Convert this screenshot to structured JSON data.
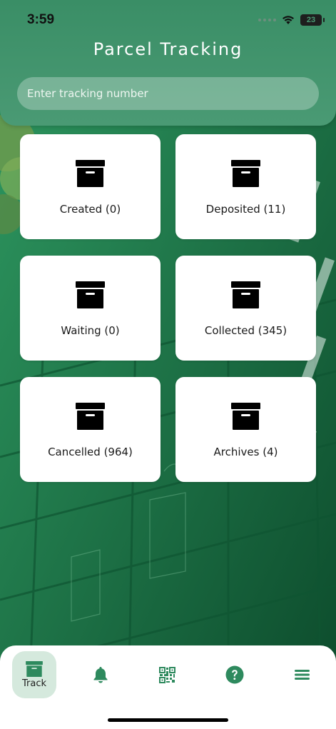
{
  "status_bar": {
    "time": "3:59",
    "battery": "23"
  },
  "header": {
    "title": "Parcel Tracking",
    "search_placeholder": "Enter tracking number"
  },
  "cards": [
    {
      "label": "Created (0)",
      "icon": "archive-box-icon"
    },
    {
      "label": "Deposited (11)",
      "icon": "archive-box-icon"
    },
    {
      "label": "Waiting (0)",
      "icon": "archive-box-icon"
    },
    {
      "label": "Collected (345)",
      "icon": "archive-box-icon"
    },
    {
      "label": "Cancelled (964)",
      "icon": "archive-box-icon"
    },
    {
      "label": "Archives (4)",
      "icon": "archive-box-icon"
    }
  ],
  "tabbar": {
    "items": [
      {
        "label": "Track",
        "icon": "archive-box-icon",
        "active": true
      },
      {
        "label": "",
        "icon": "bell-icon"
      },
      {
        "label": "",
        "icon": "qr-code-icon"
      },
      {
        "label": "",
        "icon": "help-icon"
      },
      {
        "label": "",
        "icon": "menu-icon"
      }
    ]
  },
  "colors": {
    "accent": "#2e8a5e",
    "header": "#4a9a74",
    "active_tab_bg": "#d5e9dd",
    "card_bg": "#ffffff"
  }
}
